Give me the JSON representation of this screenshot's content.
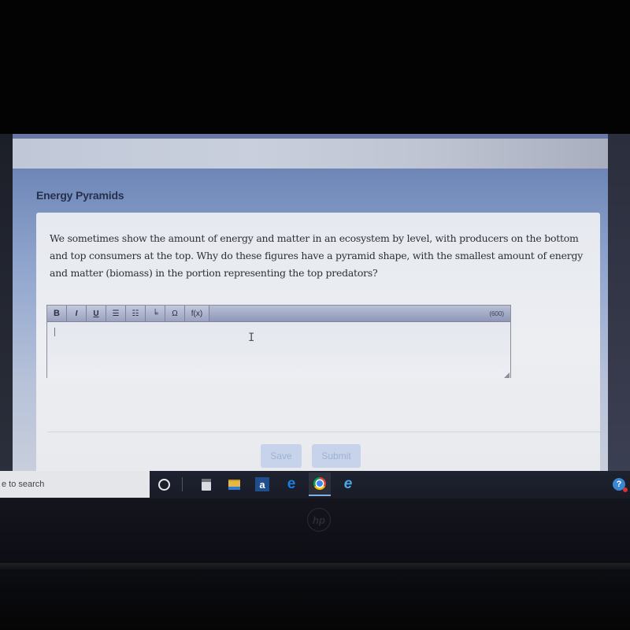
{
  "page": {
    "section_title": "Energy Pyramids",
    "question": "We sometimes show the amount of energy and matter in an ecosystem by level, with producers on the bottom and top consumers at the top. Why do these figures have a pyramid shape, with the smallest amount of energy and matter (biomass) in the portion representing the top predators?"
  },
  "editor": {
    "toolbar": [
      {
        "name": "bold",
        "label": "B"
      },
      {
        "name": "italic",
        "label": "I"
      },
      {
        "name": "underline",
        "label": "U"
      },
      {
        "name": "bulleted-list",
        "label": "☰"
      },
      {
        "name": "numbered-list",
        "label": "☷"
      },
      {
        "name": "subscript",
        "label": "╘"
      },
      {
        "name": "special-characters",
        "label": "Ω"
      },
      {
        "name": "formula",
        "label": "f(x)"
      }
    ],
    "char_count": "(600)",
    "value": ""
  },
  "actions": {
    "save_label": "Save",
    "submit_label": "Submit"
  },
  "taskbar": {
    "search_placeholder": "e to search",
    "apps": [
      "cortana",
      "calculator",
      "file-explorer",
      "amazon",
      "edge",
      "chrome",
      "internet-explorer"
    ],
    "amazon_glyph": "a",
    "edge_glyph": "e",
    "ie_glyph": "e",
    "help_glyph": "?"
  },
  "device": {
    "logo": "hp"
  }
}
